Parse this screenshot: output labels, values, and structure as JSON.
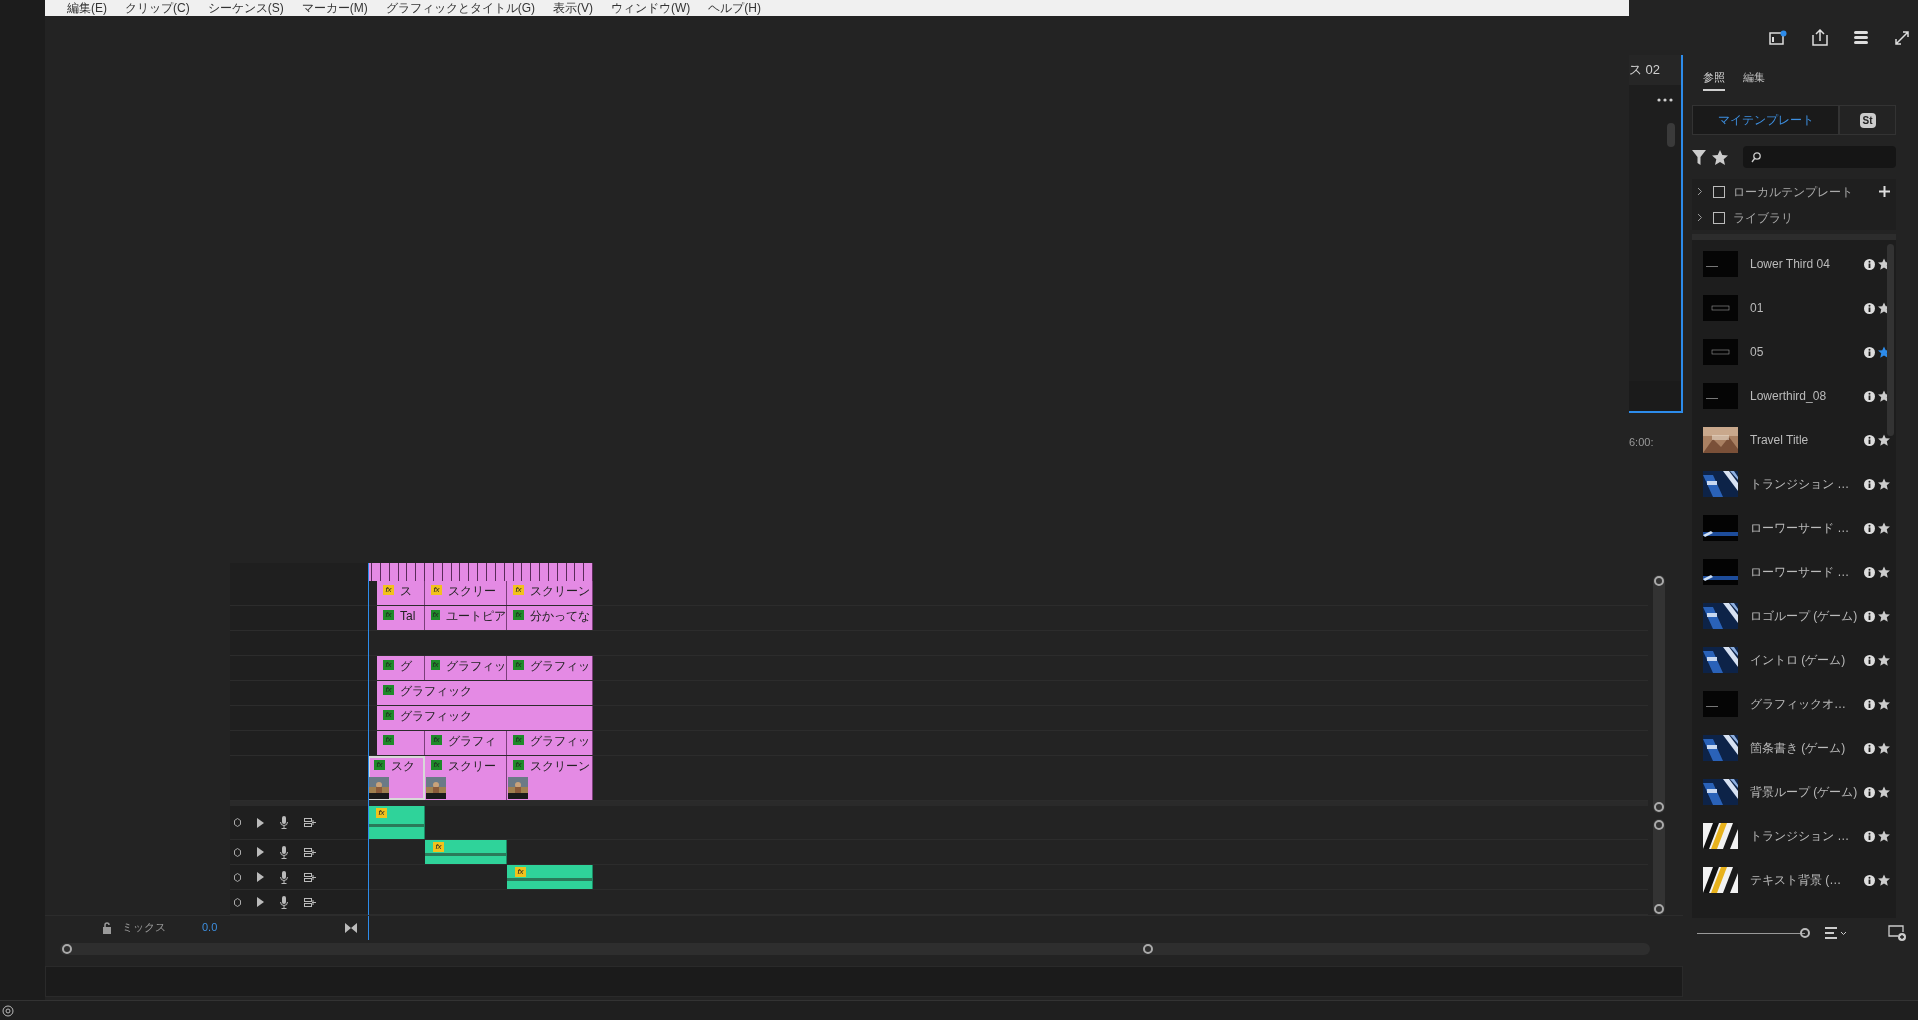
{
  "menu": [
    "編集(E)",
    "クリップ(C)",
    "シーケンス(S)",
    "マーカー(M)",
    "グラフィックとタイトル(G)",
    "表示(V)",
    "ウィンドウ(W)",
    "ヘルプ(H)"
  ],
  "monitor": {
    "tab": "ス 02",
    "timecode": "6:00:"
  },
  "panel": {
    "tabs": [
      {
        "label": "参照",
        "selected": true
      },
      {
        "label": "編集",
        "selected": false
      }
    ],
    "sources": [
      {
        "label": "マイテンプレート",
        "selected": true
      },
      {
        "label": "St",
        "selected": false
      }
    ],
    "size_slider": {
      "level": 1
    },
    "folders": [
      {
        "label": "ローカルテンプレート",
        "checked": false,
        "can_add": true
      },
      {
        "label": "ライブラリ",
        "checked": false,
        "can_add": false
      }
    ],
    "templates": [
      {
        "name": "Lower Third 04",
        "kind": "dark",
        "starred": false
      },
      {
        "name": "01",
        "kind": "dark-box",
        "starred": false
      },
      {
        "name": "05",
        "kind": "dark-box",
        "starred": true
      },
      {
        "name": "Lowerthird_08",
        "kind": "dark",
        "starred": false
      },
      {
        "name": "Travel Title",
        "starred": false
      },
      {
        "name": "トランジション …",
        "kind": "blue",
        "starred": false
      },
      {
        "name": "ローワーサード …",
        "kind": "lower-blue",
        "starred": false
      },
      {
        "name": "ローワーサード …",
        "kind": "lower-blue",
        "starred": false
      },
      {
        "name": "ロゴループ (ゲーム)",
        "kind": "blue",
        "starred": false
      },
      {
        "name": "イントロ (ゲーム)",
        "kind": "blue",
        "starred": false
      },
      {
        "name": "グラフィックオ…",
        "kind": "dark",
        "starred": false
      },
      {
        "name": "箇条書き (ゲーム)",
        "kind": "blue",
        "starred": false
      },
      {
        "name": "背景ループ (ゲーム)",
        "kind": "blue",
        "starred": false
      },
      {
        "name": "トランジション …",
        "kind": "gold",
        "starred": false
      },
      {
        "name": "テキスト背景 (…",
        "kind": "gold",
        "starred": false
      }
    ]
  },
  "timeline": {
    "video_tracks": [
      {
        "kind": "graphics",
        "clips": [
          {
            "label": "ス",
            "badge": "fx",
            "color": "#f2c21b",
            "selected": false
          },
          {
            "label": "スクリー",
            "badge": "fx",
            "color": "#f2c21b",
            "selected": false
          },
          {
            "label": "スクリーン",
            "badge": "fx",
            "color": "#f2c21b",
            "selected": false
          }
        ]
      },
      {
        "kind": "graphics",
        "clips": [
          {
            "label": "Tal",
            "badge": "fx",
            "color": "#1f8a2a",
            "selected": false
          },
          {
            "label": "ユートピア",
            "badge": "fx",
            "color": "#1f8a2a",
            "selected": false
          },
          {
            "label": "分かってな",
            "badge": "fx",
            "color": "#1f8a2a",
            "selected": false
          }
        ]
      },
      {
        "kind": "graphics"
      },
      {
        "kind": "graphics",
        "clips": [
          {
            "label": "グ",
            "badge": "fx",
            "color": "#1f8a2a",
            "selected": false
          },
          {
            "label": "グラフィッ",
            "badge": "fx",
            "color": "#1f8a2a",
            "selected": false
          },
          {
            "label": "グラフィッ",
            "badge": "fx",
            "color": "#1f8a2a",
            "selected": false
          }
        ]
      },
      {
        "kind": "graphics",
        "clips": [
          {
            "label": "グラフィック",
            "badge": "fx",
            "color": "#1f8a2a",
            "selected": false
          }
        ]
      },
      {
        "kind": "graphics",
        "clips": [
          {
            "label": "グラフィック",
            "badge": "fx",
            "color": "#1f8a2a",
            "selected": false
          }
        ]
      },
      {
        "kind": "graphics",
        "clips": [
          {
            "badge": "fx",
            "color": "#1f8a2a",
            "selected": false
          },
          {
            "label": "グラフィ",
            "badge": "fx",
            "color": "#1f8a2a",
            "selected": false
          },
          {
            "label": "グラフィッ",
            "badge": "fx",
            "color": "#1f8a2a",
            "selected": false
          }
        ]
      },
      {
        "kind": "video",
        "clips": [
          {
            "label": "スク",
            "badge": "fx",
            "color": "#1f8a2a",
            "selected": true,
            "kind": "video"
          },
          {
            "label": "スクリー",
            "badge": "fx",
            "color": "#1f8a2a",
            "selected": false,
            "kind": "video"
          },
          {
            "label": "スクリーン",
            "badge": "fx",
            "color": "#1f8a2a",
            "selected": false,
            "kind": "video"
          }
        ]
      }
    ],
    "audio_tracks": [
      {
        "kind": "audio",
        "clip": {
          "badge": "fx",
          "color": "#f2c21b"
        }
      },
      {
        "kind": "audio",
        "clip": {
          "badge": "fx",
          "color": "#f2c21b"
        }
      },
      {
        "kind": "audio",
        "clip": {
          "badge": "fx",
          "color": "#f2c21b"
        }
      },
      {
        "kind": "audio"
      }
    ],
    "mix": {
      "label": "ミックス",
      "value": "0.0"
    }
  }
}
